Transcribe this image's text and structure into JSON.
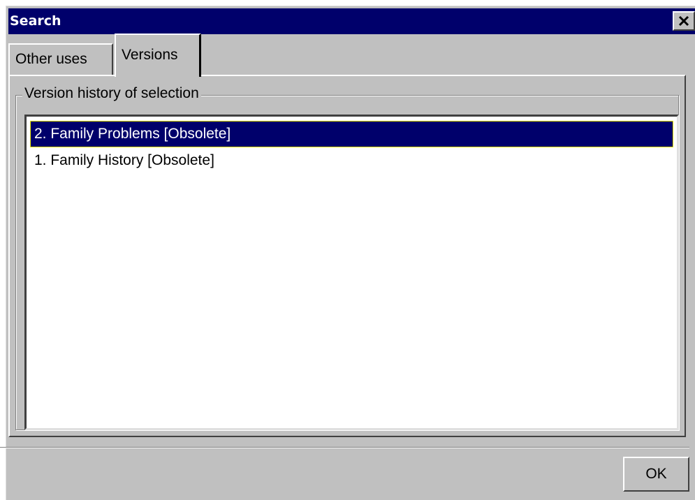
{
  "window": {
    "title": "Search"
  },
  "tabs": [
    {
      "label": "Other uses",
      "selected": false
    },
    {
      "label": "Versions",
      "selected": true
    }
  ],
  "group": {
    "legend": "Version history of selection"
  },
  "versions": [
    {
      "label": "2. Family Problems [Obsolete]",
      "selected": true
    },
    {
      "label": "1. Family History [Obsolete]",
      "selected": false
    }
  ],
  "buttons": {
    "ok_label": "OK"
  },
  "icons": {
    "close": "close-icon"
  },
  "colors": {
    "titlebar": "#00006b",
    "selection": "#00006b",
    "selection_border": "#e6e600",
    "face": "#c0c0c0"
  }
}
